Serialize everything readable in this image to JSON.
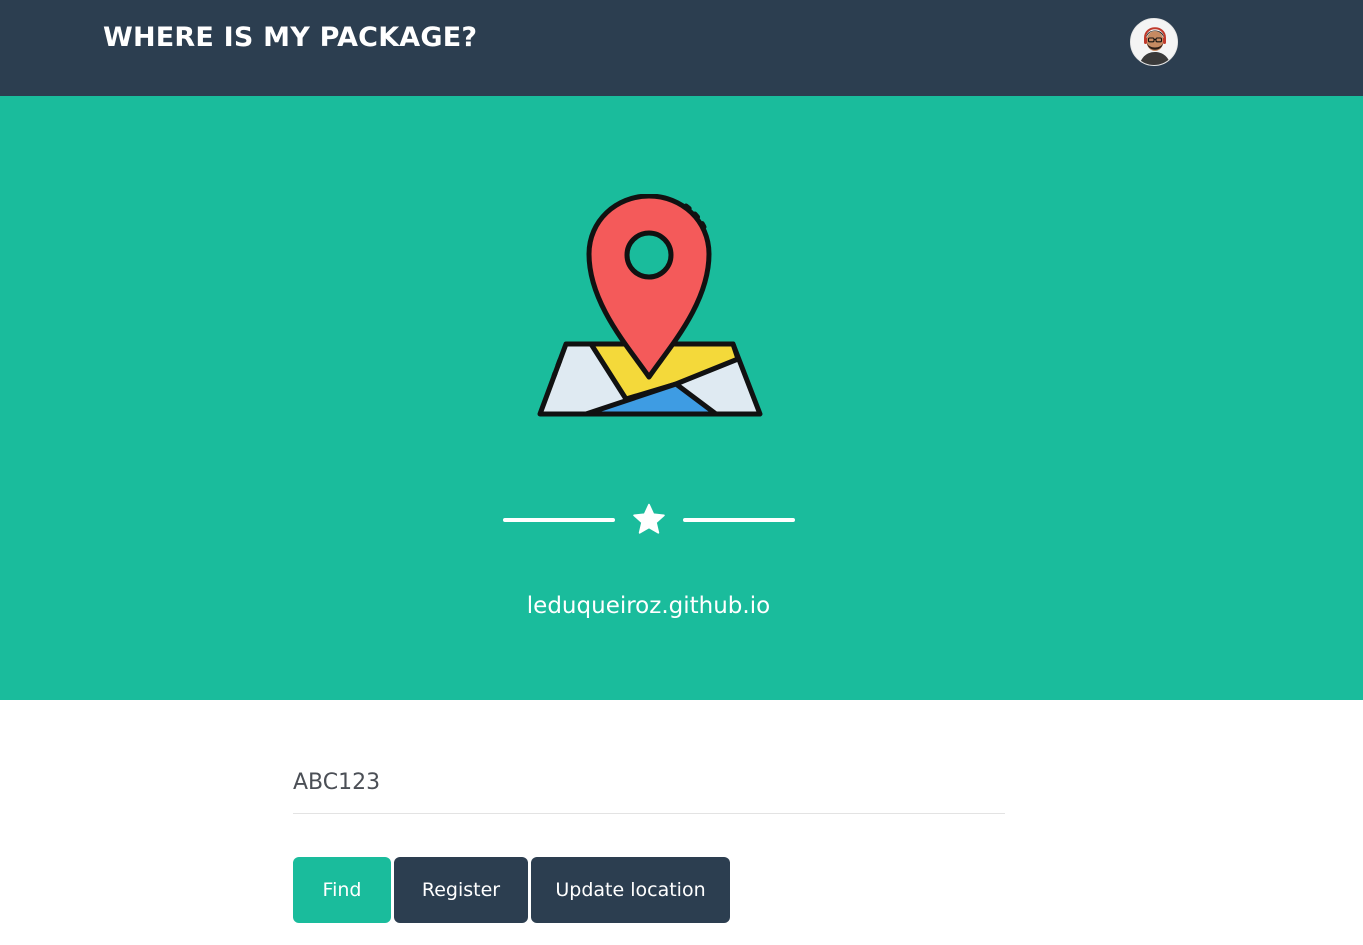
{
  "navbar": {
    "brand": "WHERE IS MY PACKAGE?",
    "avatar_icon": "user-avatar"
  },
  "masthead": {
    "icon": "map-location-pin-icon",
    "divider_icon": "star-icon",
    "subheading": "leduqueiroz.github.io"
  },
  "form": {
    "code_value": "ABC123",
    "find_label": "Find",
    "register_label": "Register",
    "update_label": "Update location"
  },
  "colors": {
    "navbar_bg": "#2c3e50",
    "masthead_bg": "#1abc9c",
    "primary_button": "#1abc9c",
    "secondary_button": "#2c3e50",
    "pin_red": "#f45a5a",
    "map_yellow": "#f4d93a",
    "map_blue": "#3e9ce3",
    "map_light": "#dfeaf2"
  }
}
